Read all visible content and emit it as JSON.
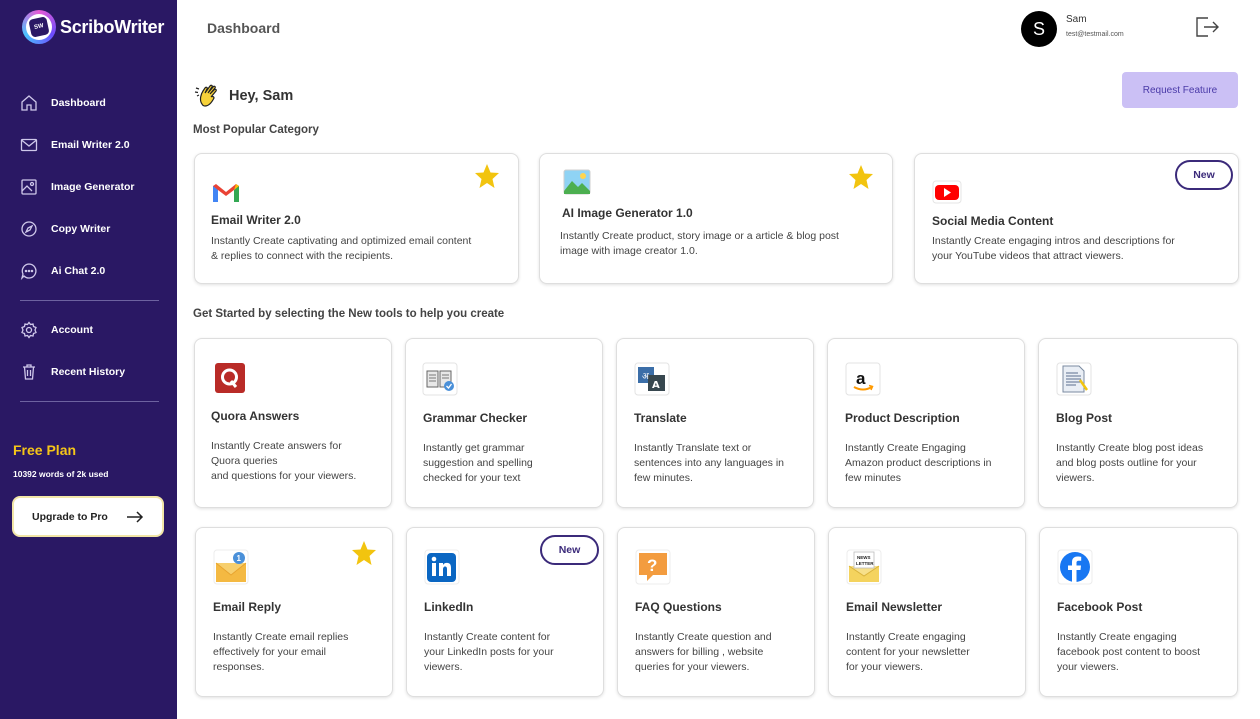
{
  "app": {
    "name": "ScriboWriter",
    "logo_mark": "SW"
  },
  "sidebar": {
    "items": [
      {
        "label": "Dashboard",
        "icon": "home-icon"
      },
      {
        "label": "Email Writer 2.0",
        "icon": "mail-icon"
      },
      {
        "label": "Image Generator",
        "icon": "image-icon"
      },
      {
        "label": "Copy Writer",
        "icon": "compass-icon"
      },
      {
        "label": "Ai Chat 2.0",
        "icon": "chat-icon"
      },
      {
        "label": "Account",
        "icon": "gear-icon"
      },
      {
        "label": "Recent History",
        "icon": "trash-icon"
      }
    ],
    "plan": {
      "title": "Free Plan",
      "usage": "10392 words of 2k used"
    },
    "upgrade_label": "Upgrade to Pro"
  },
  "header": {
    "title": "Dashboard",
    "user": {
      "initial": "S",
      "name": "Sam",
      "email": "test@testmail.com"
    }
  },
  "greeting": "Hey, Sam",
  "request_feature_label": "Request Feature",
  "popular": {
    "title": "Most Popular Category",
    "cards": [
      {
        "title": "Email Writer 2.0",
        "desc": "Instantly Create captivating and optimized email content\n& replies to connect with the recipients.",
        "icon": "gmail-icon",
        "star": true
      },
      {
        "title": "AI Image Generator 1.0",
        "desc": "Instantly Create product, story image or a article & blog post\nimage with image creator 1.0.",
        "icon": "image-generator-icon",
        "star": true
      },
      {
        "title": "Social Media Content",
        "desc": "Instantly Create engaging intros and descriptions for\nyour YouTube videos that attract viewers.",
        "icon": "youtube-icon",
        "badge": "New"
      }
    ]
  },
  "new_tools": {
    "title": "Get Started by selecting the New tools to help you create",
    "cards": [
      {
        "title": "Quora Answers",
        "desc": "Instantly Create answers for\nQuora queries\nand questions  for your viewers.",
        "icon": "quora-icon"
      },
      {
        "title": "Grammar Checker",
        "desc": "Instantly get grammar\nsuggestion and spelling\nchecked for your text",
        "icon": "book-icon"
      },
      {
        "title": "Translate",
        "desc": "Instantly Translate text or\nsentences into any languages in\nfew minutes.",
        "icon": "translate-icon"
      },
      {
        "title": "Product Description",
        "desc": "Instantly Create Engaging\nAmazon product descriptions in\nfew minutes",
        "icon": "amazon-icon"
      },
      {
        "title": "Blog Post",
        "desc": "Instantly Create blog post ideas\nand blog posts outline for your\nviewers.",
        "icon": "document-icon"
      },
      {
        "title": "Email Reply",
        "desc": "Instantly Create email replies\neffectively for your email\nresponses.",
        "icon": "envelope-notification-icon",
        "star": true
      },
      {
        "title": "LinkedIn",
        "desc": "Instantly Create content for\nyour LinkedIn posts for your\nviewers.",
        "icon": "linkedin-icon",
        "badge": "New"
      },
      {
        "title": "FAQ Questions",
        "desc": "Instantly Create question and\nanswers for billing , website\nqueries  for your viewers.",
        "icon": "question-bubble-icon"
      },
      {
        "title": "Email Newsletter",
        "desc": "Instantly Create engaging\ncontent for your newsletter\nfor your viewers.",
        "icon": "newsletter-icon"
      },
      {
        "title": "Facebook Post",
        "desc": "Instantly Create engaging\nfacebook post content to boost\nyour viewers.",
        "icon": "facebook-icon"
      }
    ]
  },
  "colors": {
    "sidebar": "#2a1864",
    "accent": "#cbc0f5",
    "plan": "#f5c518",
    "badge": "#3b2a7a"
  }
}
